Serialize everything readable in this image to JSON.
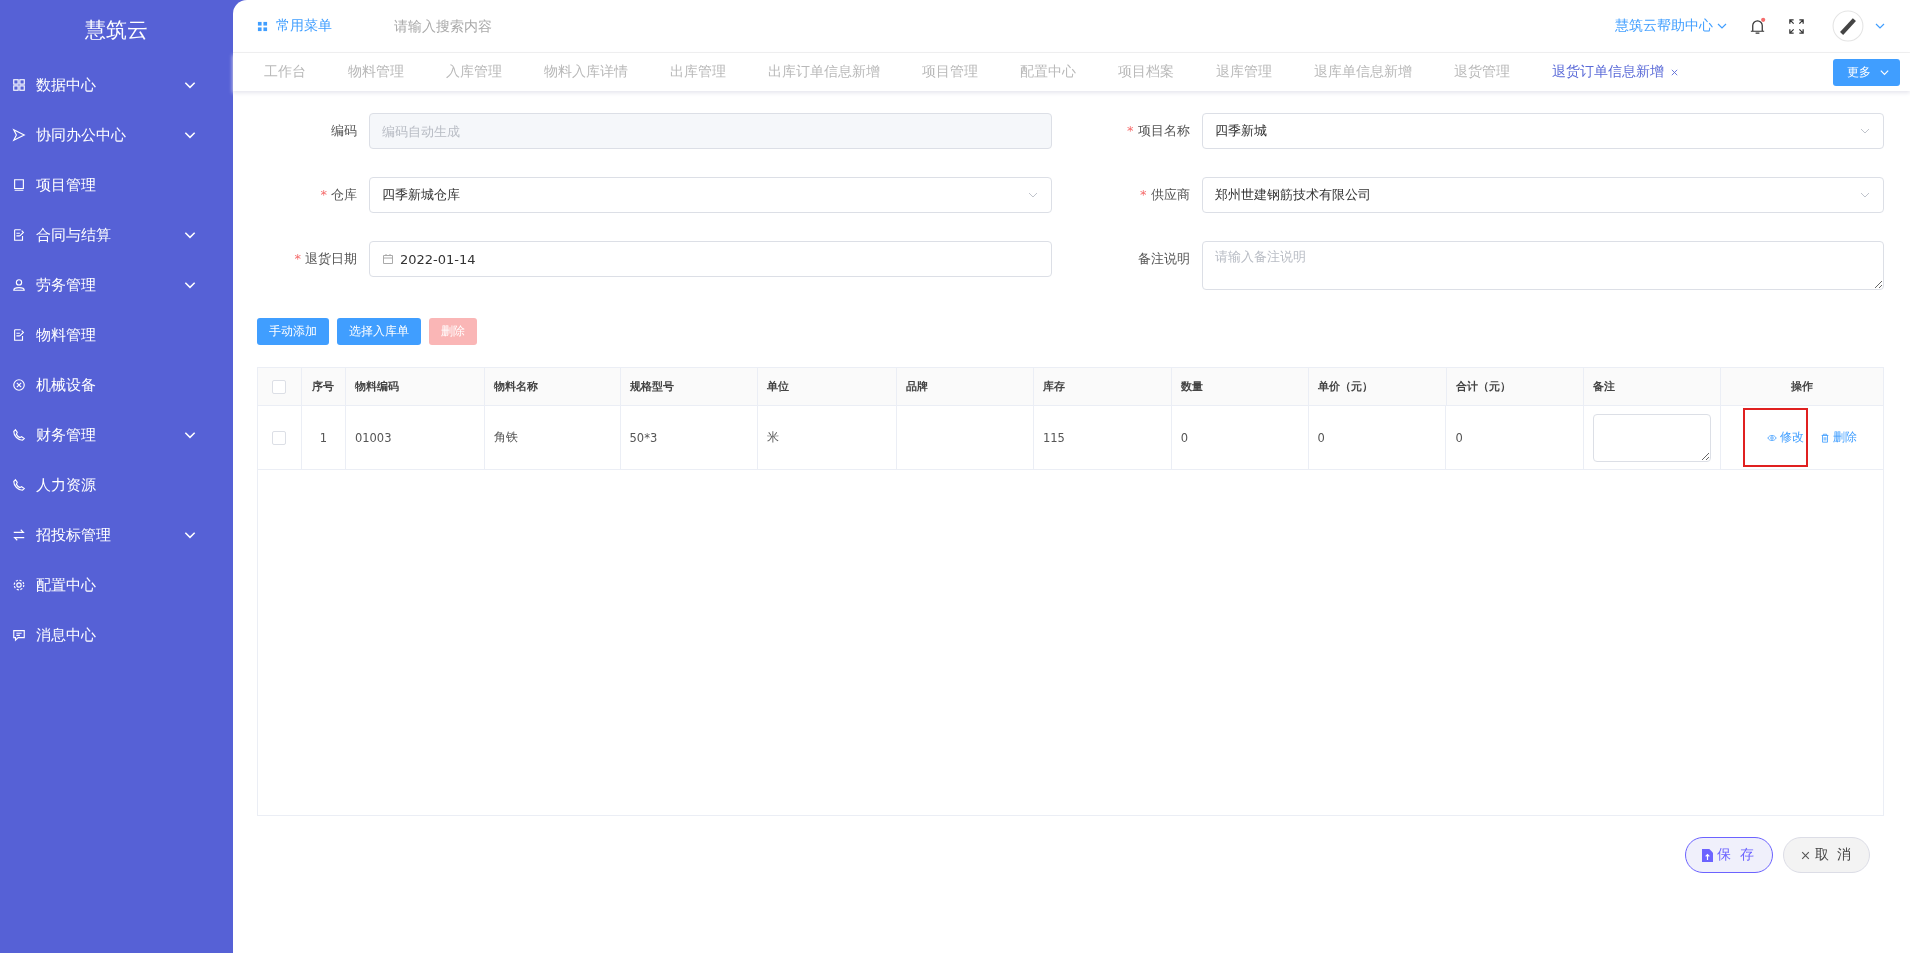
{
  "sidebar": {
    "title": "慧筑云",
    "items": [
      {
        "label": "数据中心",
        "expandable": true
      },
      {
        "label": "协同办公中心",
        "expandable": true
      },
      {
        "label": "项目管理",
        "expandable": false
      },
      {
        "label": "合同与结算",
        "expandable": true
      },
      {
        "label": "劳务管理",
        "expandable": true
      },
      {
        "label": "物料管理",
        "expandable": false
      },
      {
        "label": "机械设备",
        "expandable": false
      },
      {
        "label": "财务管理",
        "expandable": true
      },
      {
        "label": "人力资源",
        "expandable": false
      },
      {
        "label": "招投标管理",
        "expandable": true
      },
      {
        "label": "配置中心",
        "expandable": false
      },
      {
        "label": "消息中心",
        "expandable": false
      }
    ]
  },
  "header": {
    "menu": "常用菜单",
    "search": {
      "placeholder": "请输入搜索内容"
    },
    "help": "慧筑云帮助中心",
    "notification_dot": true
  },
  "tabs": [
    {
      "label": "工作台",
      "selected": false
    },
    {
      "label": "物料管理",
      "selected": false
    },
    {
      "label": "入库管理",
      "selected": false
    },
    {
      "label": "物料入库详情",
      "selected": false
    },
    {
      "label": "出库管理",
      "selected": false
    },
    {
      "label": "出库订单信息新增",
      "selected": false
    },
    {
      "label": "项目管理",
      "selected": false
    },
    {
      "label": "配置中心",
      "selected": false
    },
    {
      "label": "项目档案",
      "selected": false
    },
    {
      "label": "退库管理",
      "selected": false
    },
    {
      "label": "退库单信息新增",
      "selected": false
    },
    {
      "label": "退货管理",
      "selected": false
    },
    {
      "label": "退货订单信息新增",
      "selected": true
    }
  ],
  "more_button": "更多",
  "form": {
    "fields": [
      {
        "label": "编码",
        "kind": "disabled",
        "placeholder": "编码自动生成"
      },
      {
        "label": "项目名称",
        "required_mark": "*",
        "kind": "select",
        "value": "四季新城"
      },
      {
        "label": "仓库",
        "required_mark": "*",
        "kind": "select",
        "value": "四季新城仓库"
      },
      {
        "label": "供应商",
        "required_mark": "*",
        "kind": "select",
        "value": "郑州世建钢筋技术有限公司"
      },
      {
        "label": "退货日期",
        "required_mark": "*",
        "kind": "date",
        "value": "2022-01-14"
      },
      {
        "label": "备注说明",
        "kind": "textarea",
        "placeholder": "请输入备注说明"
      }
    ]
  },
  "actions": [
    {
      "label": "手动添加",
      "disabled": false
    },
    {
      "label": "选择入库单",
      "disabled": false
    },
    {
      "label": "删除",
      "disabled": true
    }
  ],
  "table": {
    "select_all_checked": false,
    "columns": [
      "序号",
      "物料编码",
      "物料名称",
      "规格型号",
      "单位",
      "品牌",
      "库存",
      "数量",
      "单价（元）",
      "合计（元）",
      "备注",
      "操作"
    ],
    "rows": [
      {
        "checked": false,
        "cells": [
          "1",
          "01003",
          "角铁",
          "50*3",
          "米",
          "",
          "115",
          "0",
          "0",
          "0"
        ],
        "row_actions": [
          {
            "label": "修改",
            "highlighted": true
          },
          {
            "label": "删除",
            "highlighted": false
          }
        ]
      }
    ]
  },
  "footer": {
    "save": "保 存",
    "cancel": "取 消"
  }
}
